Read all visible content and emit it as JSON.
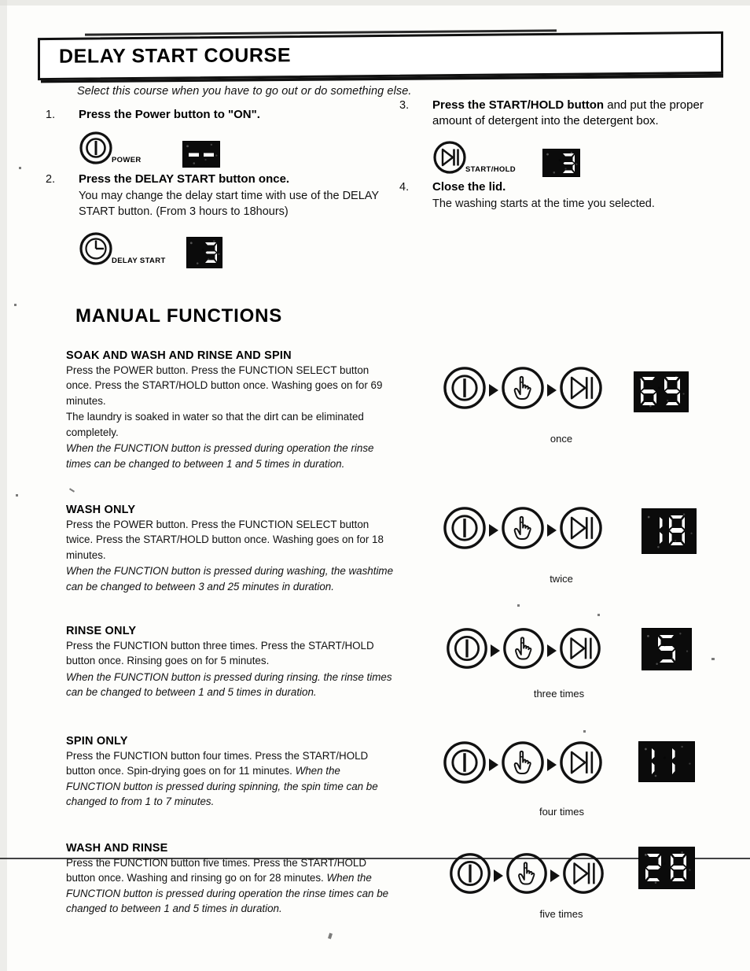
{
  "header": {
    "title": "DELAY START COURSE",
    "intro": "Select this course when you have to go out or do something else."
  },
  "delay_start_steps": [
    {
      "number": "1.",
      "head_bold": "Press the Power button to \"ON\".",
      "head_rest": "",
      "sub": "",
      "button_label": "POWER",
      "button_icon": "power-icon",
      "display_value": "- -"
    },
    {
      "number": "2.",
      "head_bold": "Press the DELAY START button once.",
      "head_rest": "",
      "sub": "You may change the delay start time with use of the DELAY START button. (From 3 hours to 18hours)",
      "button_label": "DELAY START",
      "button_icon": "clock-icon",
      "display_value": "3"
    },
    {
      "number": "3.",
      "head_bold": "Press the START/HOLD button",
      "head_rest": " and put the proper amount of detergent into the detergent box.",
      "sub": "",
      "button_label": "START/HOLD",
      "button_icon": "start-hold-icon",
      "display_value": "3"
    },
    {
      "number": "4.",
      "head_bold": "Close the lid.",
      "head_rest": "",
      "sub": "The washing starts at the time you selected.",
      "button_label": "",
      "button_icon": "",
      "display_value": ""
    }
  ],
  "manual_functions": {
    "section_title": "MANUAL FUNCTIONS",
    "items": [
      {
        "heading": "SOAK AND WASH AND RINSE AND SPIN",
        "paragraphs": [
          {
            "text": "Press the POWER button. Press the FUNCTION SELECT button once. Press the START/HOLD button once. Washing goes on for 69 minutes.",
            "italic": false
          },
          {
            "text": "The laundry is soaked in water so that the dirt can be eliminated completely.",
            "italic": false
          },
          {
            "text": "When the FUNCTION button is pressed during operation the rinse times can be changed to between 1 and 5 times in duration.",
            "italic": true
          }
        ],
        "sequence": [
          "power-icon",
          "function-hand-icon",
          "start-hold-icon"
        ],
        "caption": "once",
        "display_value": "69"
      },
      {
        "heading": "WASH ONLY",
        "paragraphs": [
          {
            "text": "Press the POWER button. Press the FUNCTION SELECT button twice. Press the START/HOLD button once. Washing goes on for 18 minutes.",
            "italic": false
          },
          {
            "text": "When the FUNCTION button is pressed during washing, the washtime can be changed to between 3 and 25 minutes in duration.",
            "italic": true
          }
        ],
        "sequence": [
          "power-icon",
          "function-hand-icon",
          "start-hold-icon"
        ],
        "caption": "twice",
        "display_value": "18"
      },
      {
        "heading": "RINSE ONLY",
        "paragraphs": [
          {
            "text": "Press the FUNCTION button three times. Press the START/HOLD button once. Rinsing goes on for 5 minutes.",
            "italic": false
          },
          {
            "text": "When the FUNCTION button is pressed during rinsing. the rinse times can be changed to between 1 and 5 times in duration.",
            "italic": true
          }
        ],
        "sequence": [
          "power-icon",
          "function-hand-icon",
          "start-hold-icon"
        ],
        "caption": "three times",
        "display_value": "5"
      },
      {
        "heading": "SPIN ONLY",
        "paragraphs": [
          {
            "text": "Press the FUNCTION button four times. Press the START/HOLD button once. Spin-drying goes on for 11 minutes.",
            "italic": false
          },
          {
            "text": "When the FUNCTION button is pressed during spinning, the spin time can be changed to from 1 to 7 minutes.",
            "italic": true
          }
        ],
        "sequence": [
          "power-icon",
          "function-hand-icon",
          "start-hold-icon"
        ],
        "caption": "four times",
        "display_value": "11"
      },
      {
        "heading": "WASH AND RINSE",
        "paragraphs": [
          {
            "text": "Press the FUNCTION button five times. Press the START/HOLD button once. Washing and rinsing go on for 28 minutes.",
            "italic": false
          },
          {
            "text": "When the FUNCTION button is pressed during operation the rinse times can be changed to between 1 and 5 times in duration.",
            "italic": true
          }
        ],
        "sequence": [
          "power-icon",
          "function-hand-icon",
          "start-hold-icon"
        ],
        "caption": "five times",
        "display_value": "28"
      }
    ]
  },
  "colors": {
    "ink": "#0a0a0a",
    "paper": "#fdfdfb",
    "led_background": "#0b0b0b",
    "led_segment": "#ffffff"
  }
}
